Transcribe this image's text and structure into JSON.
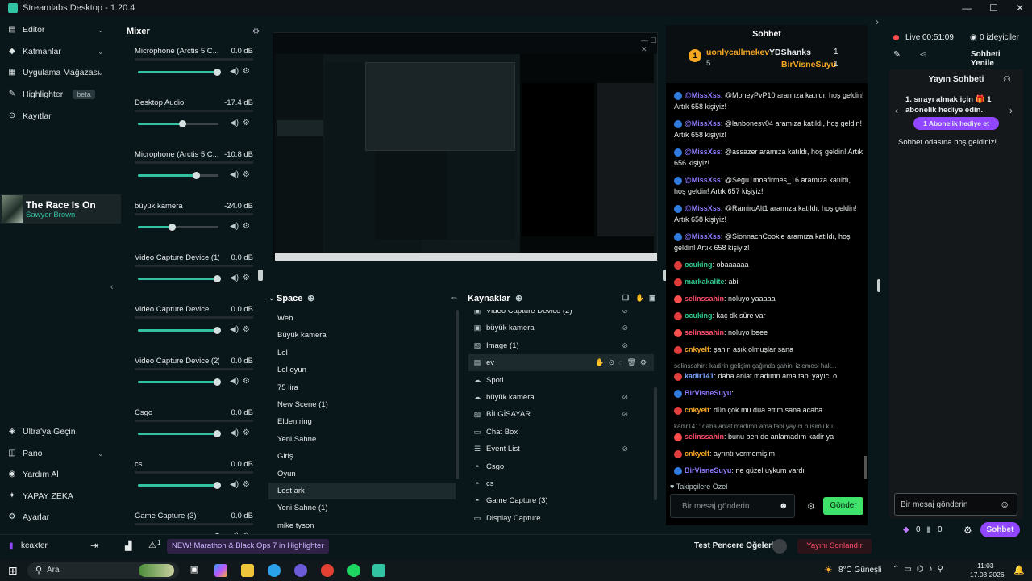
{
  "app": {
    "title": "Streamlabs Desktop - 1.20.4"
  },
  "sidebar": {
    "items": [
      {
        "label": "Editör",
        "icon": "editor-icon"
      },
      {
        "label": "Katmanlar",
        "icon": "layers-icon"
      },
      {
        "label": "Uygulama Mağazası",
        "icon": "store-icon"
      },
      {
        "label": "Highlighter",
        "icon": "highlighter-icon",
        "badge": "beta"
      },
      {
        "label": "Kayıtlar",
        "icon": "recordings-icon"
      }
    ],
    "bottom_items": [
      {
        "label": "Ultra'ya Geçin"
      },
      {
        "label": "Pano"
      },
      {
        "label": "Yardım Al"
      },
      {
        "label": "YAPAY ZEKA"
      },
      {
        "label": "Ayarlar"
      }
    ],
    "user": "keaxter"
  },
  "now_playing": {
    "title": "The Race Is On",
    "artist": "Sawyer Brown"
  },
  "mixer": {
    "title": "Mixer",
    "rows": [
      {
        "name": "Microphone (Arctis 5 C...",
        "db": "0.0 dB",
        "level": 0.98
      },
      {
        "name": "Desktop Audio",
        "db": "-17.4 dB",
        "level": 0.55
      },
      {
        "name": "Microphone (Arctis 5 C...",
        "db": "-10.8 dB",
        "level": 0.72
      },
      {
        "name": "büyük kamera",
        "db": "-24.0 dB",
        "level": 0.42
      },
      {
        "name": "Video Capture Device (1)",
        "db": "0.0 dB",
        "level": 0.98
      },
      {
        "name": "Video Capture Device",
        "db": "0.0 dB",
        "level": 0.98
      },
      {
        "name": "Video Capture Device (2)",
        "db": "0.0 dB",
        "level": 0.98
      },
      {
        "name": "Csgo",
        "db": "0.0 dB",
        "level": 0.98
      },
      {
        "name": "cs",
        "db": "0.0 dB",
        "level": 0.98
      },
      {
        "name": "Game Capture (3)",
        "db": "0.0 dB",
        "level": 0.98
      }
    ]
  },
  "scenes": {
    "title": "Space",
    "items": [
      "Web",
      "Büyük kamera",
      "Lol",
      "Lol oyun",
      "75 lira",
      "New Scene (1)",
      "Elden ring",
      "Yeni Sahne",
      "Giriş",
      "Oyun",
      "Lost ark",
      "Yeni Sahne (1)",
      "mike tyson"
    ],
    "selected": 10
  },
  "sources": {
    "title": "Kaynaklar",
    "items": [
      {
        "label": "Video Capture Device (2)",
        "icon": "camera-icon"
      },
      {
        "label": "büyük kamera",
        "icon": "camera-icon"
      },
      {
        "label": "Image (1)",
        "icon": "image-icon"
      },
      {
        "label": "ev",
        "icon": "folder-icon"
      },
      {
        "label": "Spoti",
        "icon": "cloud-icon"
      },
      {
        "label": "büyük kamera",
        "icon": "cloud-icon"
      },
      {
        "label": "BİLGİSAYAR",
        "icon": "image-icon"
      },
      {
        "label": "Chat Box",
        "icon": "chat-icon"
      },
      {
        "label": "Event List",
        "icon": "list-icon"
      },
      {
        "label": "Csgo",
        "icon": "gamepad-icon"
      },
      {
        "label": "cs",
        "icon": "gamepad-icon"
      },
      {
        "label": "Game Capture (3)",
        "icon": "gamepad-icon"
      },
      {
        "label": "Display Capture",
        "icon": "monitor-icon"
      }
    ],
    "selected": 3
  },
  "chat": {
    "title": "Sohbet",
    "leaderboard": [
      {
        "name": "uonlycallmekev",
        "count": "5"
      },
      {
        "name": "YDShanks",
        "count": "1"
      },
      {
        "name": "BirVisneSuyu",
        "count": "1"
      }
    ],
    "messages": [
      {
        "user": "@MissXss",
        "text": ": @MoneyPvP10 aramıza katıldı, hoş geldin! Artık 658 kişiyiz!",
        "cls": "usr-b"
      },
      {
        "user": "@MissXss",
        "text": ": @lanbonesv04 aramıza katıldı, hoş geldin! Artık 658 kişiyiz!",
        "cls": "usr-b"
      },
      {
        "user": "@MissXss",
        "text": ": @assazer aramıza katıldı, hoş geldin! Artık 656 kişiyiz!",
        "cls": "usr-b"
      },
      {
        "user": "@MissXss",
        "text": ": @Segu1moafirmes_16 aramıza katıldı, hoş geldin! Artık 657 kişiyiz!",
        "cls": "usr-b"
      },
      {
        "user": "@MissXss",
        "text": ": @RamiroAlt1 aramıza katıldı, hoş geldin! Artık 658 kişiyiz!",
        "cls": "usr-b"
      },
      {
        "user": "@MissXss",
        "text": ": @SionnachCookie aramıza katıldı, hoş geldin! Artık 658 kişiyiz!",
        "cls": "usr-b"
      },
      {
        "user": "ocuking",
        "text": ": obaaaaaa",
        "cls": "usr-t"
      },
      {
        "user": "markakalite",
        "text": ": abi",
        "cls": "usr-t"
      },
      {
        "user": "selinssahin",
        "text": ": noluyo yaaaaa",
        "cls": "usr-r"
      },
      {
        "user": "ocuking",
        "text": ": kaç dk süre var",
        "cls": "usr-t"
      },
      {
        "user": "selinssahin",
        "text": ": noluyo beee",
        "cls": "usr-r"
      },
      {
        "user": "cnkyelf",
        "text": ": şahin aşık olmuşlar sana",
        "cls": "usr-y"
      },
      {
        "user": "kadir141",
        "text": ": daha anlat madımn ama tabi yayıcı o",
        "cls": "usr-d",
        "reply": "selinssahin: kadirin gelişim çağında şahini izlemesi hak..."
      },
      {
        "user": "BirVisneSuyu",
        "text": ":",
        "cls": "usr-b"
      },
      {
        "user": "cnkyelf",
        "text": ": dün çok mu dua ettim sana acaba",
        "cls": "usr-y"
      },
      {
        "user": "selinssahin",
        "text": ": bunu ben de anlamadım kadir ya",
        "cls": "usr-r",
        "reply": "kadir141: daha anlat madımn ama tabi yayıcı o isimli ku..."
      },
      {
        "user": "cnkyelf",
        "text": ": ayrıntı vermemişim",
        "cls": "usr-y"
      },
      {
        "user": "BirVisneSuyu",
        "text": ": ne güzel uykum vardı",
        "cls": "usr-b"
      }
    ],
    "followers_only": "Takipçilere Özel",
    "input_placeholder": "Bir mesaj gönderin",
    "send_label": "Gönder"
  },
  "right": {
    "live_label": "Live",
    "live_time": "00:51:09",
    "viewers": "0 izleyiciler",
    "refresh_label": "Sohbeti Yenile",
    "stream_chat_title": "Yayın Sohbeti",
    "promo_text": "1. sırayı almak için 🎁 1 abonelik hediye edin.",
    "promo_button": "1 Abonelik hediye et",
    "welcome": "Sohbet odasına hoş geldiniz!",
    "input_placeholder": "Bir mesaj gönderin",
    "bits": "0",
    "points": "0",
    "chat_button": "Sohbet"
  },
  "bottombar": {
    "notification_count": "1",
    "news": "NEW! Marathon & Black Ops 7 in Highlighter",
    "test_label": "Test Pencere Öğeleri",
    "end_stream": "Yayını Sonlandır"
  },
  "taskbar": {
    "search_placeholder": "Ara",
    "weather": "8°C  Güneşli",
    "time": "11:03",
    "date": "17.03.2026"
  },
  "colors": {
    "accent": "#31c3a2",
    "twitch": "#9147ff",
    "send": "#3fe36a",
    "end": "#ff4d6a"
  }
}
